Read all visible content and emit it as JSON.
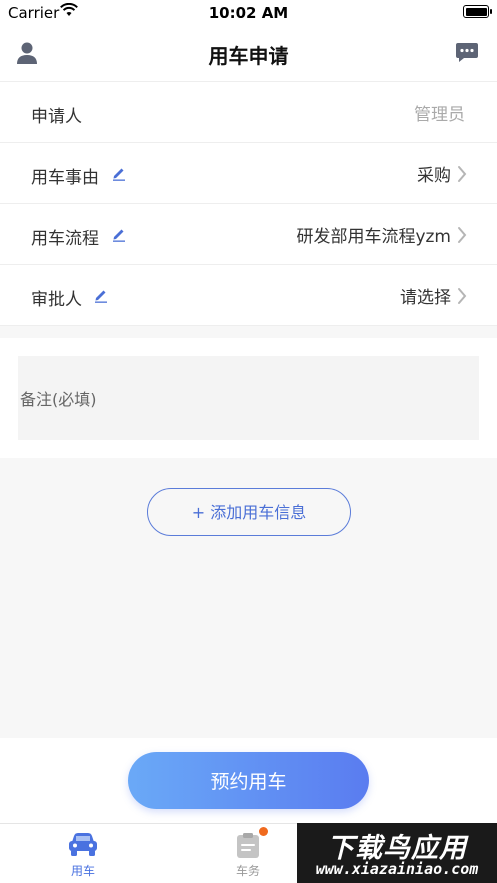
{
  "status_bar": {
    "carrier": "Carrier",
    "time": "10:02 AM"
  },
  "nav": {
    "title": "用车申请",
    "left_icon": "user-icon",
    "right_icon": "message-icon"
  },
  "form": {
    "rows": [
      {
        "label": "申请人",
        "value": "管理员",
        "editable": false,
        "has_chevron": false
      },
      {
        "label": "用车事由",
        "value": "采购",
        "editable": true,
        "has_chevron": true
      },
      {
        "label": "用车流程",
        "value": "研发部用车流程yzm",
        "editable": true,
        "has_chevron": true
      },
      {
        "label": "审批人",
        "value": "请选择",
        "editable": true,
        "has_chevron": true
      }
    ]
  },
  "remark": {
    "placeholder": "备注(必填)"
  },
  "add_vehicle_button": {
    "label": "+ 添加用车信息"
  },
  "book_button": {
    "label": "预约用车"
  },
  "tab_bar": {
    "tabs": [
      {
        "label": "用车",
        "icon": "car-icon",
        "active": true,
        "badge": false
      },
      {
        "label": "车务",
        "icon": "clipboard-icon",
        "active": false,
        "badge": true
      }
    ]
  },
  "watermark": {
    "main": "下载鸟应用",
    "sub": "www.xiazainiao.com"
  },
  "colors": {
    "accent": "#4a72e0",
    "button_gradient_start": "#6aa9f7",
    "button_gradient_end": "#5a7cf0",
    "badge": "#f06a1e",
    "placeholder_text": "#aaaaaa",
    "background_gray": "#f7f7f7"
  }
}
